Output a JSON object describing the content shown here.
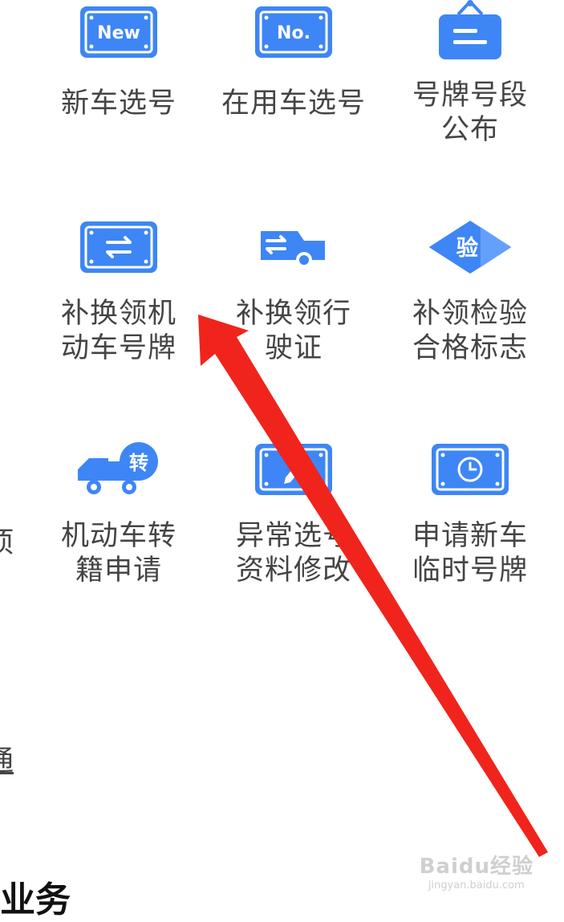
{
  "colors": {
    "accent": "#3e86f5",
    "accent_dark": "#2a6fe0",
    "arrow": "#f0241c"
  },
  "tiles": [
    {
      "label": "新车选号",
      "icon_text": "New",
      "icon": "new-plate-icon"
    },
    {
      "label": "在用车选号",
      "icon_text": "No.",
      "icon": "number-plate-icon"
    },
    {
      "label": "号牌号段公布",
      "icon": "announcement-board-icon"
    },
    {
      "label": "补换领机动车号牌",
      "icon": "plate-exchange-icon"
    },
    {
      "label": "补换领行驶证",
      "icon": "car-exchange-icon"
    },
    {
      "label": "补领检验合格标志",
      "icon_text": "验",
      "icon": "inspection-badge-icon"
    },
    {
      "label": "机动车转籍申请",
      "icon_text": "转",
      "icon": "truck-transfer-icon"
    },
    {
      "label": "异常选号资料修改",
      "icon": "plate-edit-icon"
    },
    {
      "label": "申请新车临时号牌",
      "icon": "temporary-plate-clock-icon"
    }
  ],
  "edge_fragments": {
    "left_row3": "项",
    "left_lower": "通"
  },
  "bottom_heading": "业务",
  "watermark": {
    "main": "Baidu经验",
    "sub": "jingyan.baidu.com"
  }
}
